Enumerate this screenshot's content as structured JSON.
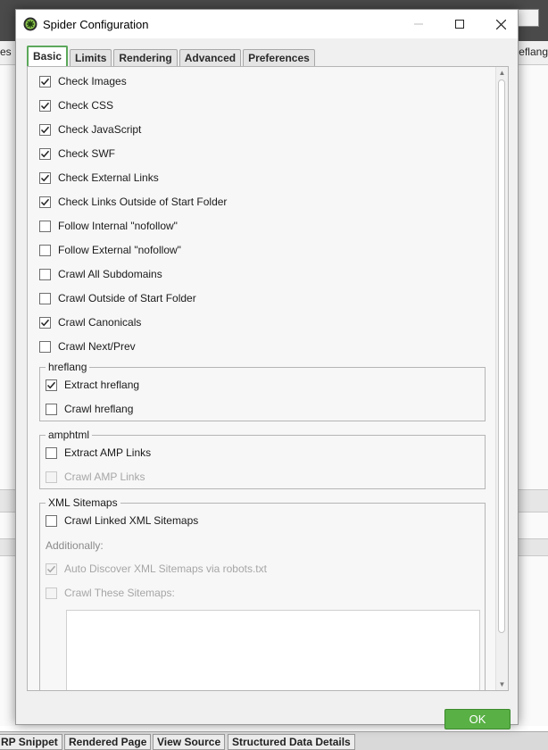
{
  "background": {
    "tab_left": "es",
    "tab_right": "eflang",
    "bottom_tabs": [
      "RP Snippet",
      "Rendered Page",
      "View Source",
      "Structured Data Details"
    ]
  },
  "dialog": {
    "title": "Spider Configuration",
    "app_icon": "spider-icon",
    "window_controls": [
      "minimize-icon",
      "maximize-icon",
      "close-icon"
    ],
    "tabs": [
      {
        "label": "Basic",
        "active": true
      },
      {
        "label": "Limits",
        "active": false
      },
      {
        "label": "Rendering",
        "active": false
      },
      {
        "label": "Advanced",
        "active": false
      },
      {
        "label": "Preferences",
        "active": false
      }
    ],
    "basic": {
      "options": [
        {
          "label": "Check Images",
          "checked": true
        },
        {
          "label": "Check CSS",
          "checked": true
        },
        {
          "label": "Check JavaScript",
          "checked": true
        },
        {
          "label": "Check SWF",
          "checked": true
        },
        {
          "label": "Check External Links",
          "checked": true
        },
        {
          "label": "Check Links Outside of Start Folder",
          "checked": true
        },
        {
          "label": "Follow Internal \"nofollow\"",
          "checked": false
        },
        {
          "label": "Follow External \"nofollow\"",
          "checked": false
        },
        {
          "label": "Crawl All Subdomains",
          "checked": false
        },
        {
          "label": "Crawl Outside of Start Folder",
          "checked": false
        },
        {
          "label": "Crawl Canonicals",
          "checked": true
        },
        {
          "label": "Crawl Next/Prev",
          "checked": false
        }
      ],
      "hreflang": {
        "legend": "hreflang",
        "options": [
          {
            "label": "Extract hreflang",
            "checked": true,
            "disabled": false
          },
          {
            "label": "Crawl hreflang",
            "checked": false,
            "disabled": false
          }
        ]
      },
      "amphtml": {
        "legend": "amphtml",
        "options": [
          {
            "label": "Extract AMP Links",
            "checked": false,
            "disabled": false
          },
          {
            "label": "Crawl AMP Links",
            "checked": false,
            "disabled": true
          }
        ]
      },
      "xml_sitemaps": {
        "legend": "XML Sitemaps",
        "crawl_linked": {
          "label": "Crawl Linked XML Sitemaps",
          "checked": false,
          "disabled": false
        },
        "additionally_label": "Additionally:",
        "auto_discover": {
          "label": "Auto Discover XML Sitemaps via robots.txt",
          "checked": true,
          "disabled": true
        },
        "crawl_these": {
          "label": "Crawl These Sitemaps:",
          "checked": false,
          "disabled": true
        },
        "sitemaps_text": ""
      }
    },
    "ok_label": "OK"
  },
  "colors": {
    "accent_green": "#59b045",
    "active_tab_border": "#5ba85b",
    "dialog_bg": "#f0f0f0"
  }
}
